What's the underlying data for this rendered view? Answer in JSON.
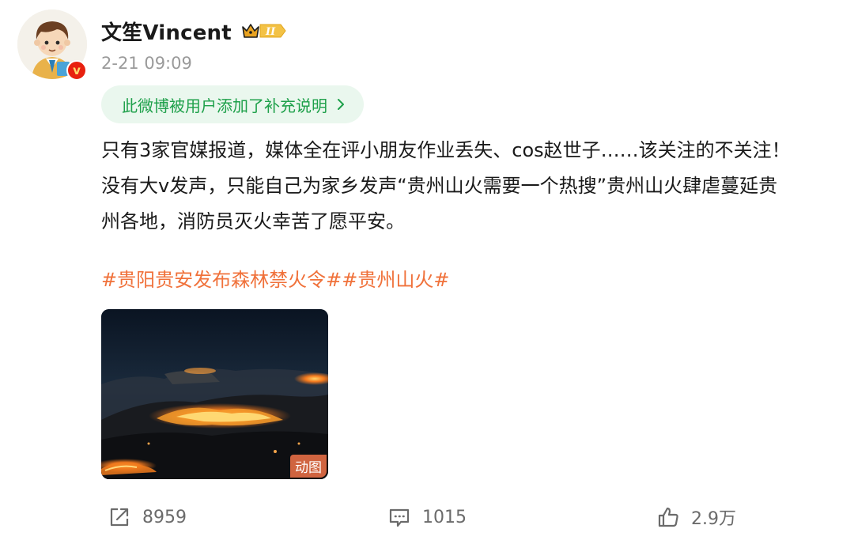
{
  "user": {
    "name": "文笙Vincent",
    "level_badge_text": "II",
    "verified_mark": "v",
    "timestamp": "2-21 09:09"
  },
  "supplement": {
    "label": "此微博被用户添加了补充说明",
    "chevron_icon": "chevron-right-icon"
  },
  "post": {
    "lines": [
      "只有3家官媒报道，媒体全在评小朋友作业丢失、cos赵世子……该关注的不关注！",
      "没有大v发声，只能自己为家乡发声“贵州山火需要一个热搜”贵州山火肆虐蔓延贵",
      "州各地，消防员灭火幸苦了愿平安。"
    ],
    "hashtags": [
      "#贵阳贵安发布森林禁火令#",
      "#贵州山火#"
    ]
  },
  "media": {
    "tag": "动图"
  },
  "actions": {
    "repost_count": "8959",
    "comment_count": "1015",
    "like_count": "2.9万"
  },
  "colors": {
    "accent_green": "#1ea04a",
    "pill_bg": "#eaf7ee",
    "hashtag_orange": "#f0713a",
    "muted_gray": "#9a9a9a",
    "verified_red": "#e8210f"
  }
}
